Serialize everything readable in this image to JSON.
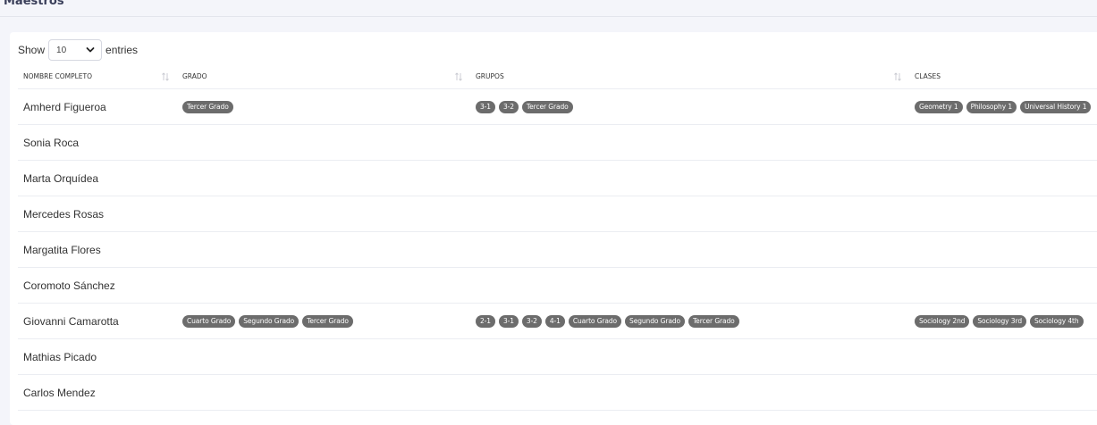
{
  "page": {
    "title": "Maestros"
  },
  "length": {
    "show_label": "Show",
    "value": "10",
    "entries_label": "entries"
  },
  "table": {
    "columns": [
      {
        "label": "NOMBRE COMPLETO"
      },
      {
        "label": "GRADO"
      },
      {
        "label": "GRUPOS"
      },
      {
        "label": "CLASES"
      }
    ],
    "rows": [
      {
        "name": "Amherd Figueroa",
        "grados": [
          "Tercer Grado"
        ],
        "grupos": [
          "3-1",
          "3-2",
          "Tercer Grado"
        ],
        "clases": [
          "Geometry 1",
          "Philosophy 1",
          "Universal History 1"
        ]
      },
      {
        "name": "Sonia Roca",
        "grados": [],
        "grupos": [],
        "clases": []
      },
      {
        "name": "Marta Orquídea",
        "grados": [],
        "grupos": [],
        "clases": []
      },
      {
        "name": "Mercedes Rosas",
        "grados": [],
        "grupos": [],
        "clases": []
      },
      {
        "name": "Margatita Flores",
        "grados": [],
        "grupos": [],
        "clases": []
      },
      {
        "name": "Coromoto Sánchez",
        "grados": [],
        "grupos": [],
        "clases": []
      },
      {
        "name": "Giovanni Camarotta",
        "grados": [
          "Cuarto Grado",
          "Segundo Grado",
          "Tercer Grado"
        ],
        "grupos": [
          "2-1",
          "3-1",
          "3-2",
          "4-1",
          "Cuarto Grado",
          "Segundo Grado",
          "Tercer Grado"
        ],
        "clases": [
          "Sociology 2nd",
          "Sociology 3rd",
          "Sociology 4th"
        ]
      },
      {
        "name": "Mathias Picado",
        "grados": [],
        "grupos": [],
        "clases": []
      },
      {
        "name": "Carlos Mendez",
        "grados": [],
        "grupos": [],
        "clases": []
      }
    ]
  }
}
